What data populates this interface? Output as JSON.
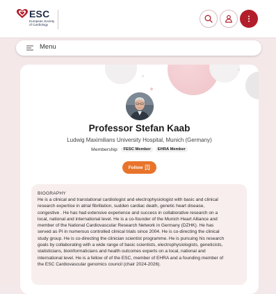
{
  "header": {
    "logo": {
      "brand": "ESC",
      "subtitle_line1": "European Society",
      "subtitle_line2": "of Cardiology"
    },
    "icons": [
      "search-icon",
      "user-icon",
      "more-vertical-icon"
    ],
    "colors": {
      "accent": "#b31e2b",
      "brand_text": "#1f2b49"
    }
  },
  "menu": {
    "label": "Menu",
    "icon": "hamburger-icon"
  },
  "profile": {
    "name": "Professor Stefan Kaab",
    "affiliation": "Ludwig Maximilians University Hospital, Munich (Germany)",
    "membership_label": "Membership:",
    "badges": [
      "FESC Member",
      "EHRA Member"
    ],
    "follow_label": "Follow",
    "follow_color": "#e8742b"
  },
  "biography": {
    "title": "BIOGRAPHY",
    "lines": [
      "He is a clinical and translational cardiologist and electrophysiologist with basic and clinical",
      "research expertise in atrial fibrillation, sudden cardiac death, genetic heart disease,",
      "congestive . He has had extensive experience and success in collaborative research on a",
      "local, national and international level. He is a co-founder of the Munich Heart Alliance and",
      "member of the National Cardiovascular Research Network in Germany (DZHK). He has",
      "served as PI in numerous controlled clinical trials since 2004. He is co-directing the clinical",
      "study group. He is co-directing the clinician scientist programme. He is pursuing his research",
      "goals by collaborating with a wide range of basic scientists, electrophysiologists, geneticists,",
      "statisticians, bioinformaticians and health outcomes experts on a local, national and",
      "international level. He is a fellow of of the ESC, member of EHRA and a founding member of",
      "the ESC Cardiovascular genomics council (chair 2024-2026)."
    ]
  }
}
